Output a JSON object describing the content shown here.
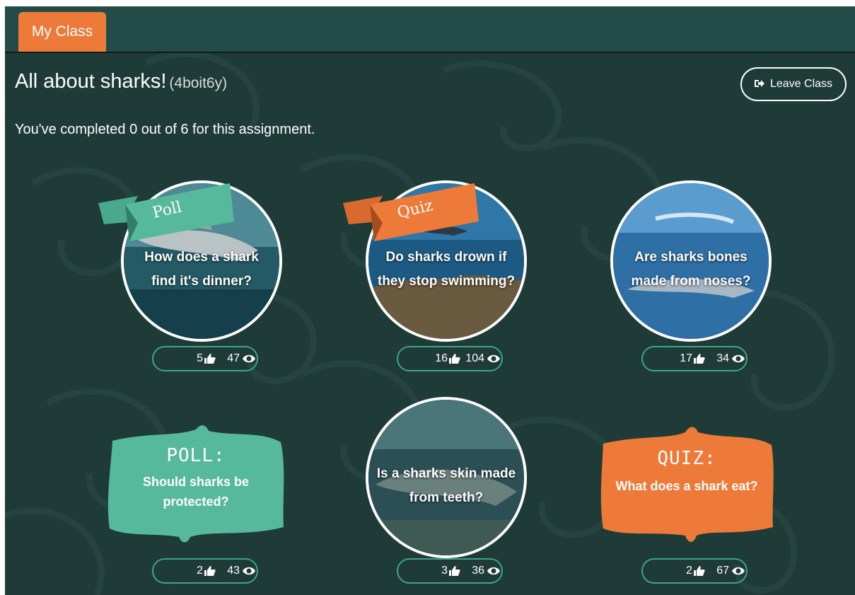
{
  "header": {
    "tab_label": "My Class"
  },
  "class_info": {
    "title": "All about sharks!",
    "code": "(4boit6y)",
    "leave_label": "Leave Class",
    "progress_text": "You've completed 0 out of 6 for this assignment."
  },
  "colors": {
    "background": "#1f3b38",
    "accent_orange": "#ee7a3a",
    "accent_teal": "#56b99c",
    "stats_border": "#3fa38a"
  },
  "cards": [
    {
      "type": "poll",
      "ribbon": "Poll",
      "question": "How does a shark find it's dinner?",
      "likes": "5",
      "views": "47"
    },
    {
      "type": "quiz",
      "ribbon": "Quiz",
      "question": "Do sharks drown if they stop swimming?",
      "likes": "16",
      "views": "104"
    },
    {
      "type": "photo",
      "question": "Are sharks bones made from noses?",
      "likes": "17",
      "views": "34"
    },
    {
      "type": "poll-sign",
      "heading": "POLL:",
      "question": "Should sharks be protected?",
      "likes": "2",
      "views": "43"
    },
    {
      "type": "photo",
      "question": "Is a sharks skin made from teeth?",
      "likes": "3",
      "views": "36"
    },
    {
      "type": "quiz-sign",
      "heading": "QUIZ:",
      "question": "What does a shark eat?",
      "likes": "2",
      "views": "67"
    }
  ],
  "icons": {
    "like": "thumbs-up-icon",
    "views": "eye-icon",
    "leave": "sign-out-icon"
  }
}
